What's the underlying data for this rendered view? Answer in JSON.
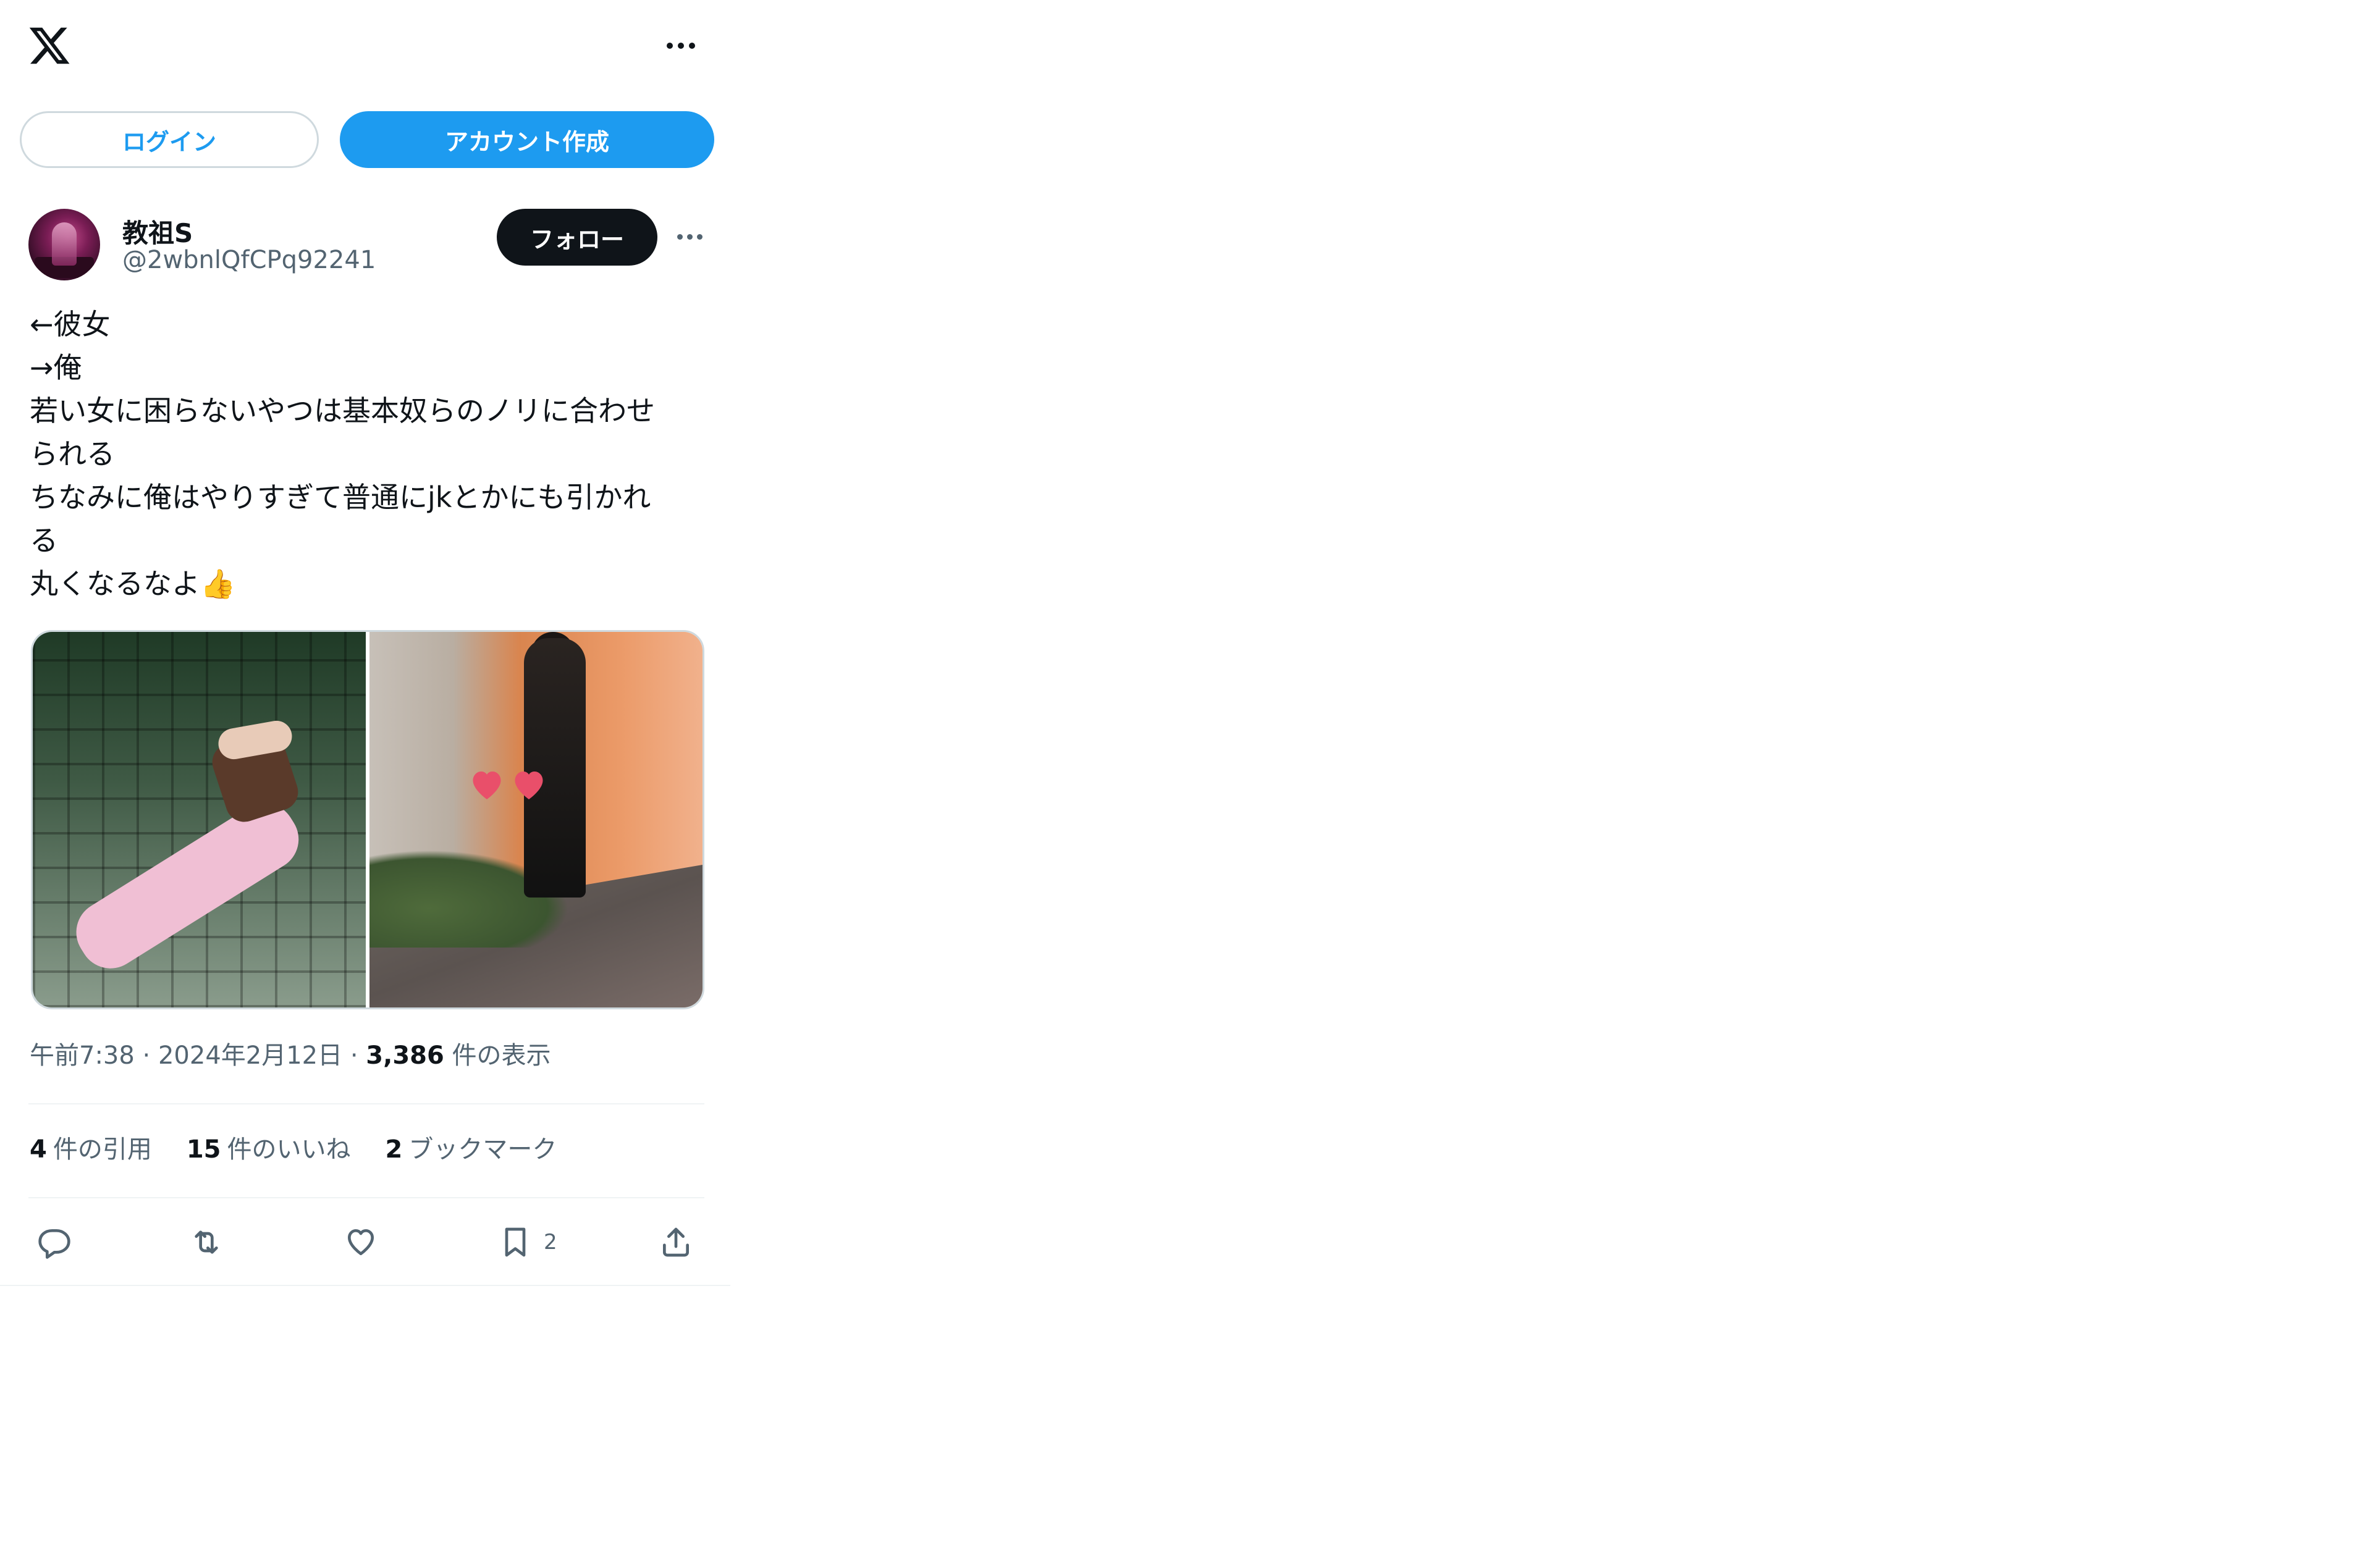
{
  "topbar": {
    "logo_icon": "x-logo-icon",
    "more_icon": "more-horizontal-icon"
  },
  "auth": {
    "login_label": "ログイン",
    "signup_label": "アカウント作成"
  },
  "author": {
    "display_name": "教祖S",
    "handle": "@2wbnlQfCPq92241",
    "follow_label": "フォロー",
    "avatar_icon": "avatar-image"
  },
  "tweet": {
    "lines": [
      "←彼女",
      "→俺",
      "若い女に困らないやつは基本奴らのノリに合わせ",
      "られる",
      "ちなみに俺はやりすぎて普通にjkとかにも引かれ",
      "る",
      "丸くなるなよ👍"
    ]
  },
  "media": {
    "photo_count": 2
  },
  "meta": {
    "time": "午前7:38",
    "separator": "·",
    "date": "2024年2月12日",
    "views_count": "3,386",
    "views_label": "件の表示"
  },
  "stats": {
    "quotes_count": "4",
    "quotes_label": "件の引用",
    "likes_count": "15",
    "likes_label": "件のいいね",
    "bookmarks_count": "2",
    "bookmarks_label": "ブックマーク"
  },
  "actions": {
    "reply_icon": "reply-icon",
    "retweet_icon": "retweet-icon",
    "like_icon": "heart-icon",
    "bookmark_icon": "bookmark-icon",
    "bookmark_count": "2",
    "share_icon": "share-icon"
  },
  "colors": {
    "accent": "#1d9bf0",
    "text": "#0f1419",
    "secondary": "#536471",
    "border": "#cfd9de"
  }
}
